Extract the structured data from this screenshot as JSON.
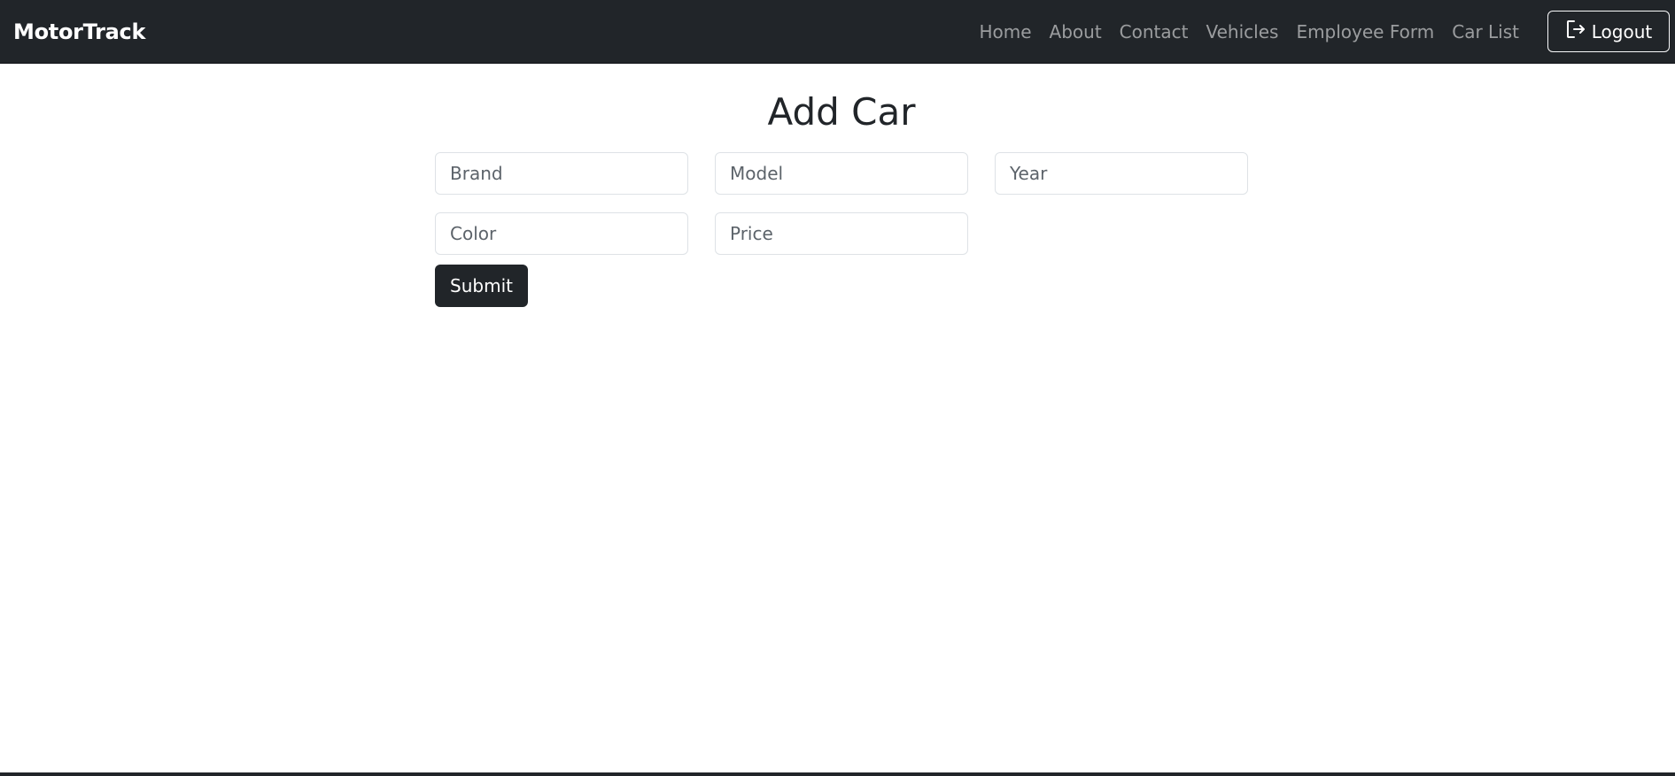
{
  "navbar": {
    "brand": "MotorTrack",
    "links": [
      {
        "label": "Home"
      },
      {
        "label": "About"
      },
      {
        "label": "Contact"
      },
      {
        "label": "Vehicles"
      },
      {
        "label": "Employee Form"
      },
      {
        "label": "Car List"
      }
    ],
    "logout": {
      "label": "Logout",
      "icon": "logout-icon"
    }
  },
  "form": {
    "title": "Add Car",
    "fields": {
      "brand": {
        "placeholder": "Brand",
        "value": ""
      },
      "model": {
        "placeholder": "Model",
        "value": ""
      },
      "year": {
        "placeholder": "Year",
        "value": ""
      },
      "color": {
        "placeholder": "Color",
        "value": ""
      },
      "price": {
        "placeholder": "Price",
        "value": ""
      }
    },
    "submit_label": "Submit"
  },
  "colors": {
    "navbar_bg": "#212529",
    "button_bg": "#212529",
    "nav_link": "#8c8f93",
    "input_border": "#dee2e6"
  }
}
